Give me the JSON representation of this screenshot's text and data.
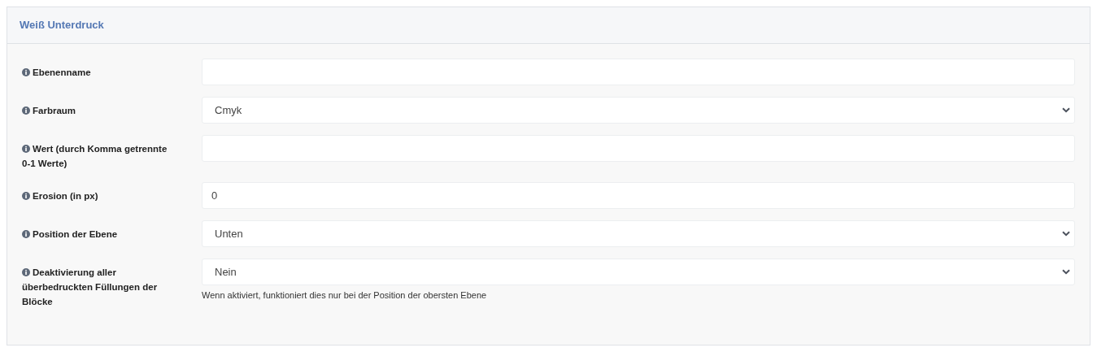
{
  "panel": {
    "title": "Weiß Unterdruck"
  },
  "fields": [
    {
      "label": "Ebenenname",
      "kind": "text"
    },
    {
      "label": "Farbraum",
      "kind": "select",
      "value": "Cmyk"
    },
    {
      "label": "Wert (durch Komma getrennte 0-1 Werte)",
      "kind": "text"
    },
    {
      "label": "Erosion (in px)",
      "kind": "text",
      "value": "0"
    },
    {
      "label": "Position der Ebene",
      "kind": "select",
      "value": "Unten"
    },
    {
      "label": "Deaktivierung aller überbedruckten Füllungen der Blöcke",
      "kind": "select",
      "value": "Nein",
      "hint": "Wenn aktiviert, funktioniert dies nur bei der Position der obersten Ebene"
    }
  ]
}
